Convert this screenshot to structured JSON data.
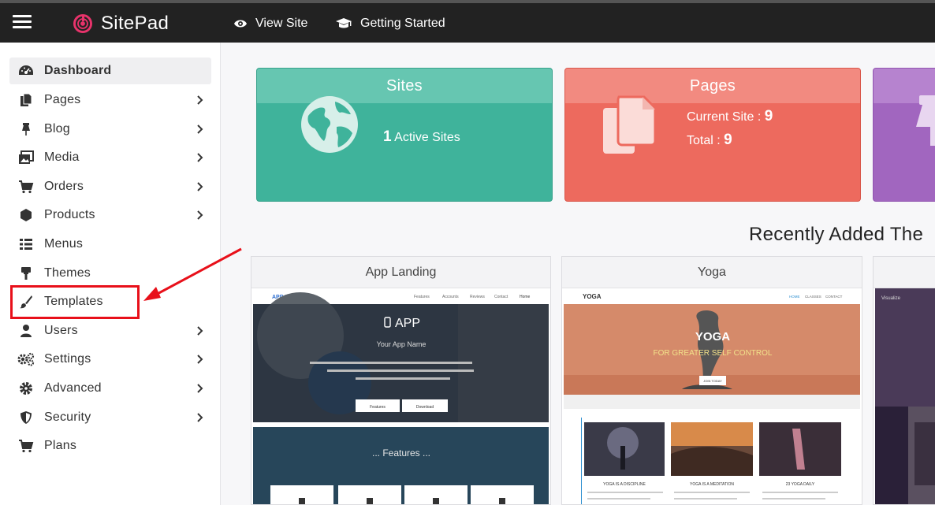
{
  "topbar": {
    "brand_name": "SitePad",
    "nav": [
      {
        "label": "View Site",
        "icon": "eye-icon"
      },
      {
        "label": "Getting Started",
        "icon": "graduation-cap-icon"
      }
    ]
  },
  "sidebar": {
    "items": [
      {
        "label": "Dashboard",
        "icon": "dashboard-icon",
        "has_submenu": false,
        "active": true
      },
      {
        "label": "Pages",
        "icon": "pages-icon",
        "has_submenu": true
      },
      {
        "label": "Blog",
        "icon": "pin-icon",
        "has_submenu": true
      },
      {
        "label": "Media",
        "icon": "media-icon",
        "has_submenu": true
      },
      {
        "label": "Orders",
        "icon": "cart-icon",
        "has_submenu": true
      },
      {
        "label": "Products",
        "icon": "hexagon-icon",
        "has_submenu": true
      },
      {
        "label": "Menus",
        "icon": "list-icon",
        "has_submenu": false
      },
      {
        "label": "Themes",
        "icon": "brush-roller-icon",
        "has_submenu": false
      },
      {
        "label": "Templates",
        "icon": "paintbrush-icon",
        "has_submenu": false
      },
      {
        "label": "Users",
        "icon": "user-icon",
        "has_submenu": true
      },
      {
        "label": "Settings",
        "icon": "gears-icon",
        "has_submenu": true
      },
      {
        "label": "Advanced",
        "icon": "gear-icon",
        "has_submenu": true
      },
      {
        "label": "Security",
        "icon": "shield-icon",
        "has_submenu": true
      },
      {
        "label": "Plans",
        "icon": "cart-icon",
        "has_submenu": false
      }
    ]
  },
  "cards": {
    "sites": {
      "title": "Sites",
      "count": "1",
      "label": "Active Sites",
      "icon": "globe-icon",
      "color": "#3fb39b"
    },
    "pages": {
      "title": "Pages",
      "current_label": "Current Site :",
      "current_value": "9",
      "total_label": "Total :",
      "total_value": "9",
      "icon": "copy-icon",
      "color": "#ed6a5e"
    },
    "third": {
      "icon": "pin-icon",
      "color": "#a166bf"
    }
  },
  "recent": {
    "title": "Recently Added The",
    "themes": [
      {
        "name": "App Landing",
        "preview": {
          "brand": "APP LANDING",
          "nav": [
            "Features",
            "Accounts",
            "Reviews",
            "Contact",
            "Home"
          ],
          "hero_title": "APP",
          "hero_subtitle": "Your App Name",
          "buttons": [
            "Features",
            "Download"
          ],
          "section": "... Features ..."
        }
      },
      {
        "name": "Yoga",
        "preview": {
          "brand": "YOGA",
          "nav": [
            "HOME",
            "CLASSES",
            "CONTACT"
          ],
          "hero_title": "YOGA",
          "hero_subtitle": "FOR GREATER SELF CONTROL",
          "hero_button": "JOIN TODAY",
          "captions": [
            "YOGA IS A DISCIPLINE",
            "YOGA IS A MEDITATION",
            "23 YOGA DAILY"
          ]
        }
      },
      {
        "name": "",
        "preview": {
          "brand": "Visualize"
        }
      }
    ]
  },
  "annotation": {
    "color": "#e8101a"
  }
}
